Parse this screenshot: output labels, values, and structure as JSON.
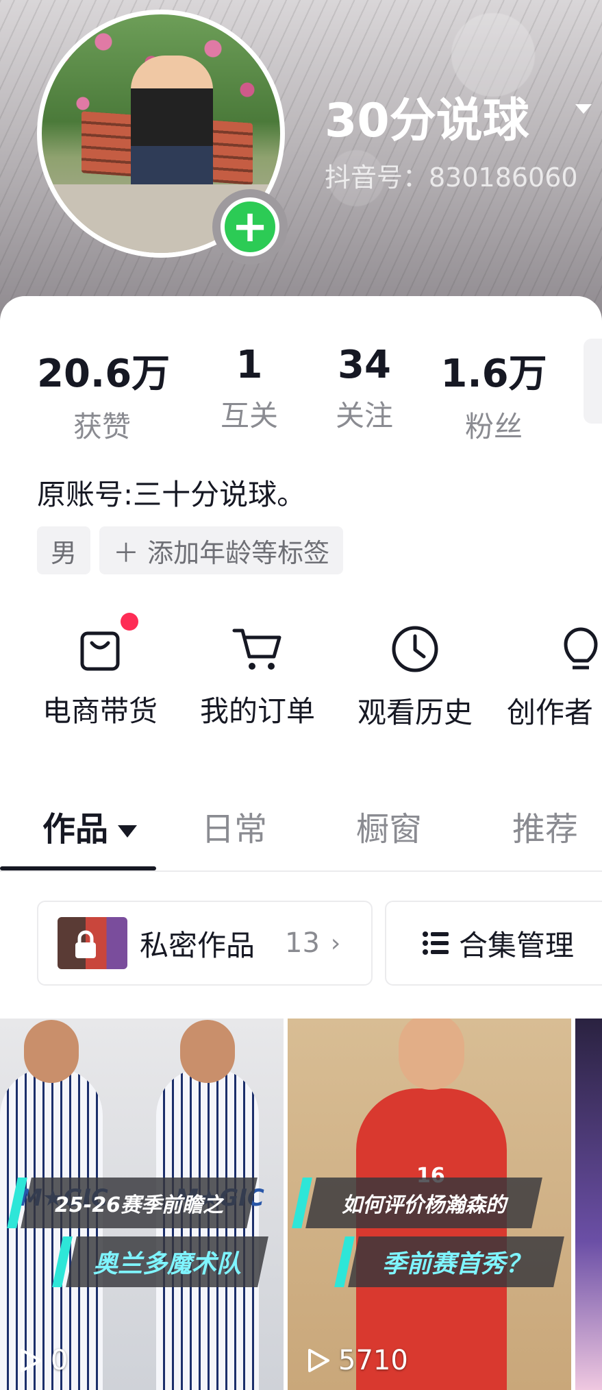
{
  "profile": {
    "name": "30分说球",
    "douyin_id": "抖音号：830186060⁦"
  },
  "stats": [
    {
      "value": "20.6万",
      "label": "获赞"
    },
    {
      "value": "1",
      "label": "互关"
    },
    {
      "value": "34",
      "label": "关注"
    },
    {
      "value": "1.6万",
      "label": "粉丝"
    }
  ],
  "bio": "原账号:三十分说球。",
  "tags": {
    "gender": "男",
    "add_tag": "＋ 添加年龄等标签"
  },
  "tools": [
    {
      "label": "电商带货",
      "icon": "shopping-bag-icon"
    },
    {
      "label": "我的订单",
      "icon": "cart-icon"
    },
    {
      "label": "观看历史",
      "icon": "clock-icon"
    },
    {
      "label": "创作者",
      "icon": "lightbulb-icon"
    }
  ],
  "tabs": [
    {
      "label": "作品"
    },
    {
      "label": "日常"
    },
    {
      "label": "橱窗"
    },
    {
      "label": "推荐"
    }
  ],
  "actions": {
    "private_label": "私密作品",
    "private_count": "13",
    "private_chevron": "›",
    "collection_label": "合集管理"
  },
  "videos": [
    {
      "line1": "25-26赛季前瞻之",
      "line2": "奥兰多魔术队",
      "plays": "0"
    },
    {
      "line1": "如何评价杨瀚森的",
      "line2": "季前赛首秀？",
      "plays": "5710"
    }
  ],
  "colors": {
    "accent_red": "#fe2c55",
    "follow_green": "#2ccb55",
    "banner_cyan": "#2ee6d8"
  }
}
